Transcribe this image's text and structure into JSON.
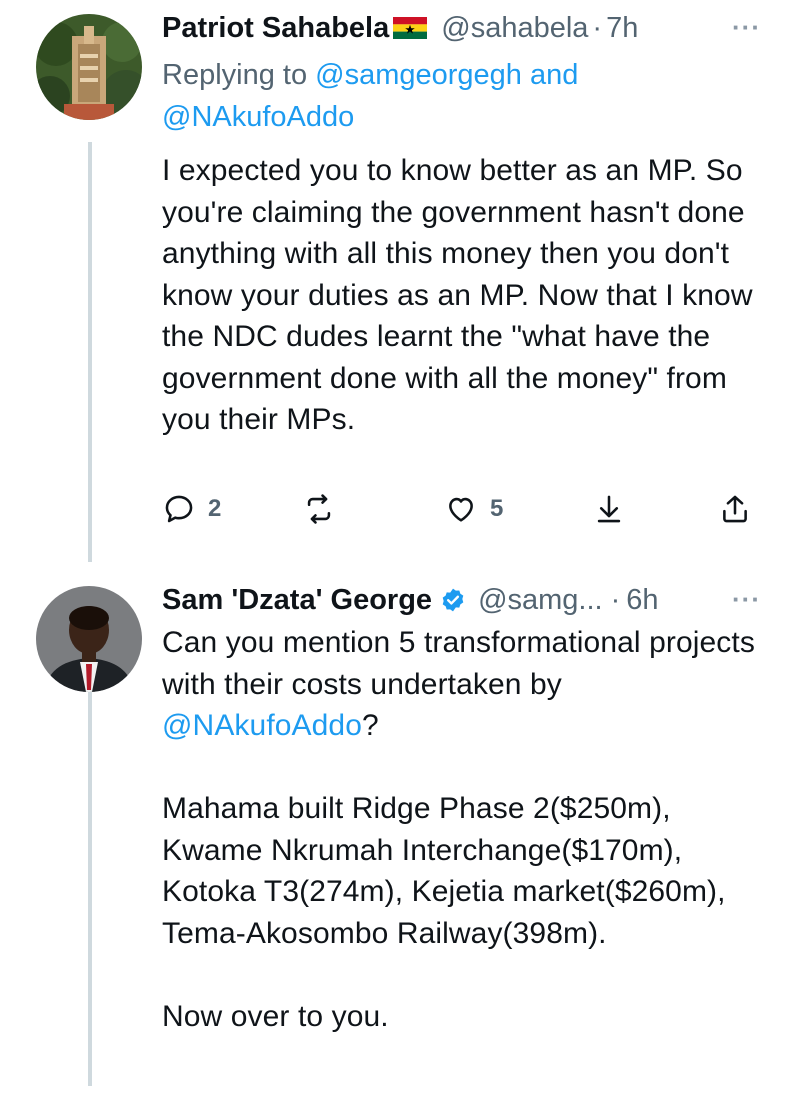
{
  "tweet1": {
    "name": "Patriot Sahabela",
    "handle": "@sahabela",
    "dot": "·",
    "time": "7h",
    "replying_prefix": "Replying to",
    "replying_user1": "@samgeorgegh",
    "replying_and": "and",
    "replying_user2": "@NAkufoAddo",
    "text": "I expected you to know better as an MP. So you're claiming the government hasn't done anything with all this money then you don't know your duties as an MP. Now that I know the NDC dudes learnt the \"what have the government done with all the money\" from you their MPs.",
    "reply_count": "2",
    "like_count": "5",
    "flag_icon": "ghana-flag-icon"
  },
  "tweet2": {
    "name": "Sam 'Dzata' George",
    "handle": "@samg...",
    "dot": "·",
    "time": "6h",
    "text_line1": "Can you mention 5 transformational projects with their costs undertaken by",
    "text_mention": "@NAkufoAddo",
    "text_q": "?",
    "text_para2": "Mahama built Ridge Phase 2($250m), Kwame Nkrumah Interchange($170m), Kotoka T3(274m), Kejetia market($260m), Tema-Akosombo Railway(398m).",
    "text_para3": "Now over to you."
  },
  "colors": {
    "link": "#1d9bf0",
    "muted": "#536471",
    "text": "#0f1419",
    "thread_line": "#cfd9de"
  }
}
